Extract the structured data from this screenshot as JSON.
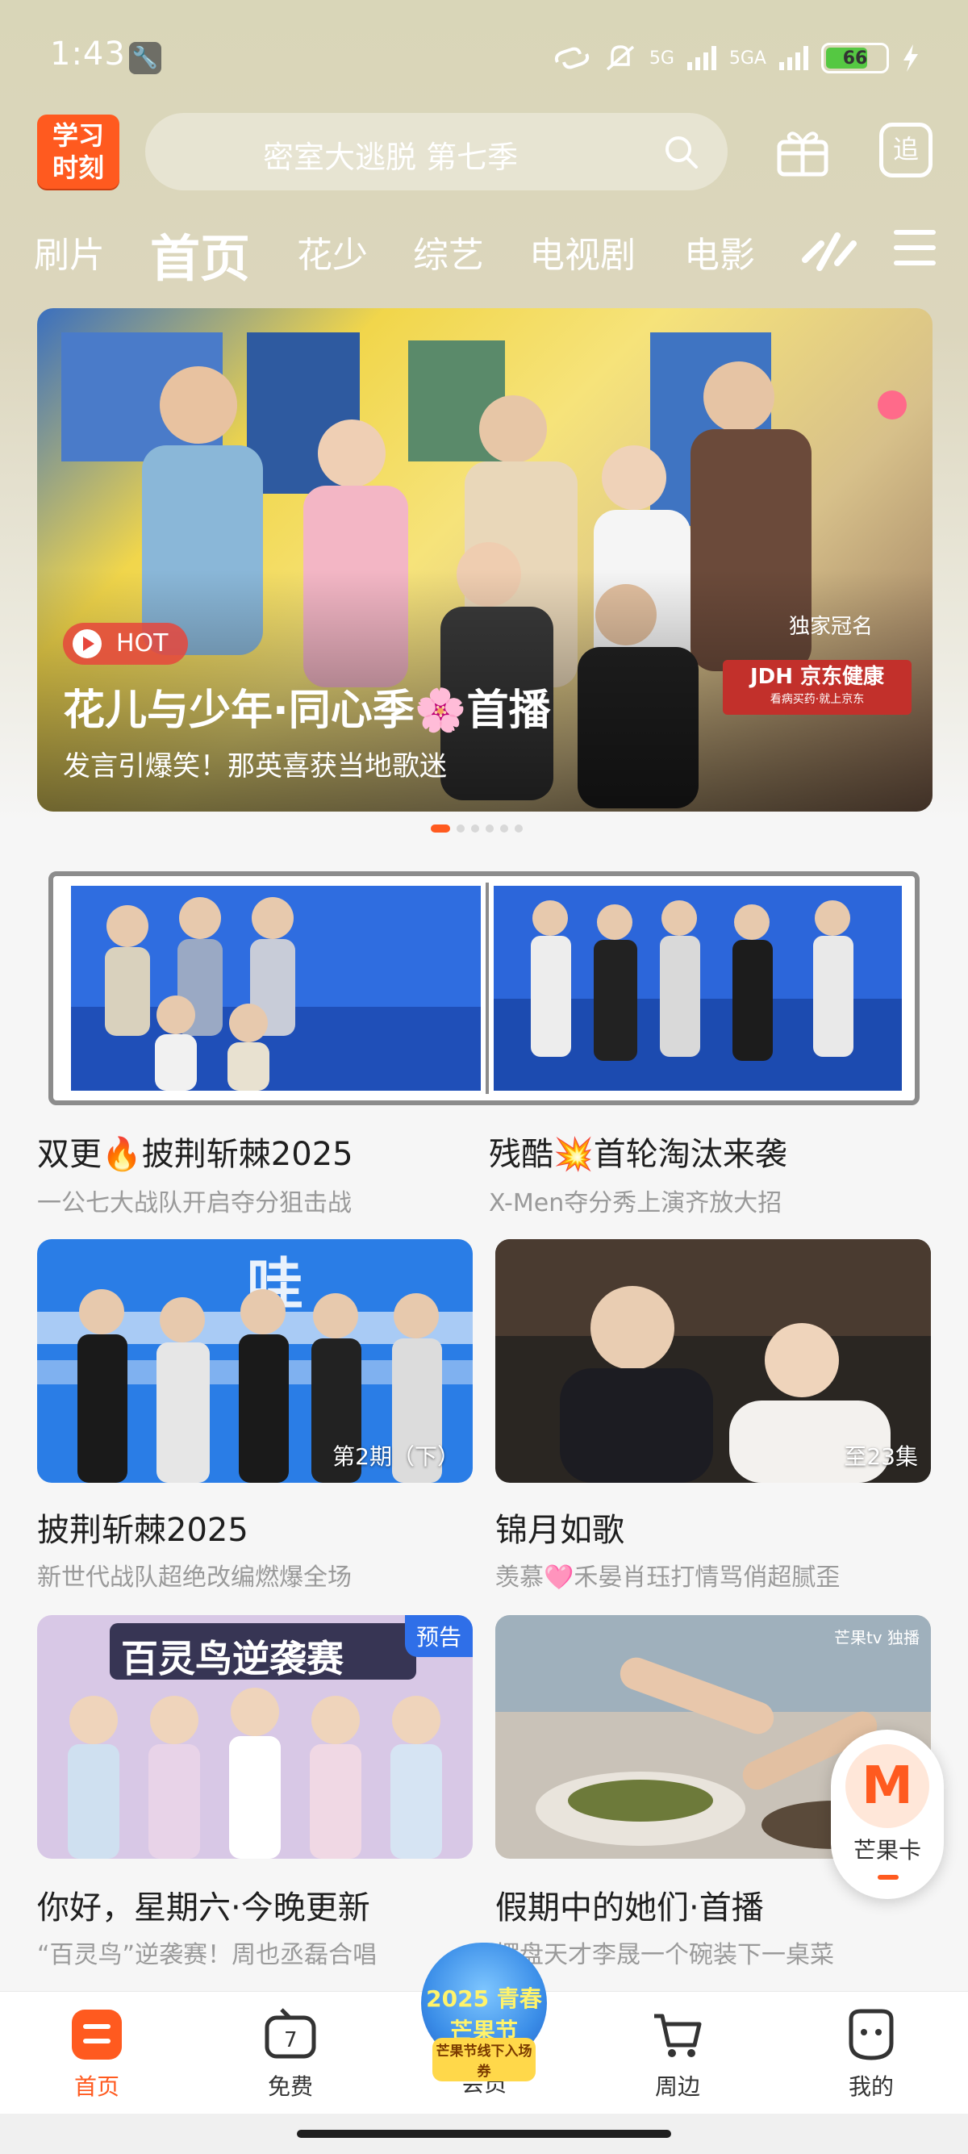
{
  "status_bar": {
    "time": "1:43",
    "network_1": "5G",
    "network_2": "5GA",
    "battery": "66"
  },
  "header": {
    "logo_line1": "学习",
    "logo_line2": "时刻",
    "search_placeholder": "密室大逃脱 第七季",
    "follow_label": "追"
  },
  "tabs": [
    "刷片",
    "首页",
    "花少",
    "综艺",
    "电视剧",
    "电影"
  ],
  "banner": {
    "badge": "HOT",
    "title": "花儿与少年·同心季🌸首播",
    "subtitle": "发言引爆笑！那英喜获当地歌迷",
    "sponsor_label": "独家冠名",
    "sponsor_name": "JDH 京东健康",
    "sponsor_tagline": "看病买药·就上京东",
    "page_count": 6,
    "active_page": 1
  },
  "cards": [
    {
      "title": "双更🔥披荆斩棘2025",
      "subtitle": "一公七大战队开启夺分狙击战",
      "episode": ""
    },
    {
      "title": "残酷💥首轮淘汰来袭",
      "subtitle": "X-Men夺分秀上演齐放大招",
      "episode": ""
    },
    {
      "title": "披荆斩棘2025",
      "subtitle": "新世代战队超绝改编燃爆全场",
      "episode": "第2期（下）"
    },
    {
      "title": "锦月如歌",
      "subtitle": "羡慕🩷禾晏肖珏打情骂俏超腻歪",
      "episode": "至23集"
    },
    {
      "title": "你好，星期六·今晚更新",
      "subtitle": "“百灵鸟”逆袭赛！周也丞磊合唱",
      "badge": "预告",
      "poster_text": "百灵鸟逆袭赛"
    },
    {
      "title": "假期中的她们·首播",
      "subtitle": "摆盘天才李晟一个碗装下一桌菜",
      "watermark": "芒果tv 独播"
    }
  ],
  "mango_card": {
    "label": "芒果卡",
    "logo": "M"
  },
  "bottom_nav": [
    {
      "label": "首页",
      "icon": "home-icon",
      "active": true
    },
    {
      "label": "免费",
      "icon": "tv-free-icon",
      "active": false
    },
    {
      "label": "会员",
      "icon": "vip-icon",
      "active": false
    },
    {
      "label": "周边",
      "icon": "cart-icon",
      "active": false
    },
    {
      "label": "我的",
      "icon": "profile-icon",
      "active": false
    }
  ],
  "vip_badge": {
    "line1": "2025 青春芒果节",
    "line2": "芒果节线下入场券"
  },
  "colors": {
    "accent": "#ff5a1f",
    "badge_blue": "#2f6fe8"
  }
}
